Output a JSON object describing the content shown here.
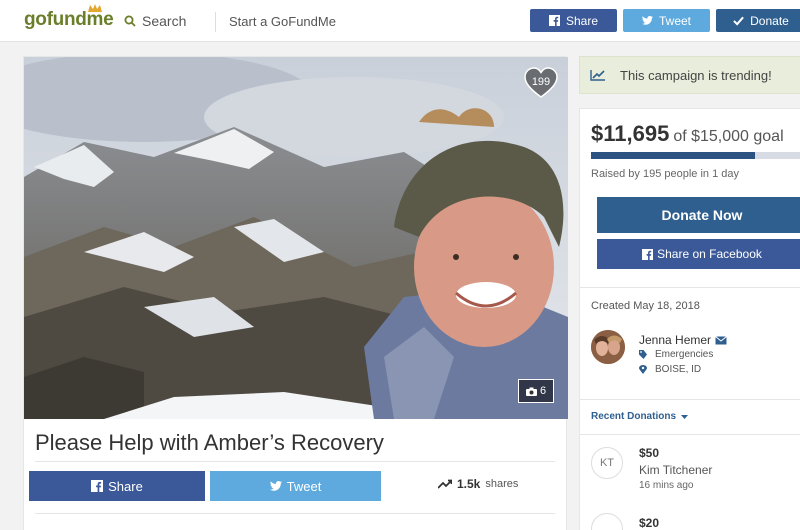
{
  "header": {
    "logo": "gofundme",
    "search_label": "Search",
    "start_label": "Start a GoFundMe",
    "share_label": "Share",
    "tweet_label": "Tweet",
    "donate_label": "Donate"
  },
  "campaign": {
    "hearts": "199",
    "photo_count": "6",
    "title": "Please Help with Amber’s Recovery",
    "share_label": "Share",
    "tweet_label": "Tweet",
    "shares_count": "1.5k",
    "shares_label": "shares"
  },
  "sidebar": {
    "trending": "This campaign is trending!",
    "raised": "$11,695",
    "goal": "of $15,000 goal",
    "progress_fraction": 0.78,
    "raised_note": "Raised by 195 people in 1 day",
    "donate_now": "Donate Now",
    "share_fb": "Share on Facebook",
    "created": "Created May 18, 2018",
    "organizer": "Jenna Hemer",
    "category": "Emergencies",
    "location": "BOISE, ID",
    "recent_donations": "Recent Donations",
    "donations": [
      {
        "initials": "KT",
        "amount": "$50",
        "name": "Kim Titchener",
        "time": "16 mins ago"
      },
      {
        "initials": "",
        "amount": "$20",
        "name": "",
        "time": ""
      }
    ]
  },
  "colors": {
    "brand_green": "#6b7f2a",
    "facebook": "#3b5998",
    "twitter": "#5ea9dd",
    "donate": "#2f5f8f"
  }
}
